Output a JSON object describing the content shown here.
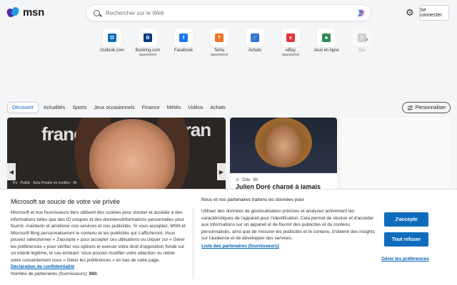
{
  "header": {
    "logo_text": "msn",
    "search_placeholder": "Rechercher sur le Web",
    "signin_label": "Se connecter"
  },
  "shortcuts": [
    {
      "label": "Outlook.com",
      "sub": "",
      "color": "#0f6cbd",
      "icon": "outlook-icon",
      "glyph": "O"
    },
    {
      "label": "Booking.com",
      "sub": "Sponsorisé",
      "color": "#003580",
      "icon": "booking-icon",
      "glyph": "B"
    },
    {
      "label": "Facebook",
      "sub": "",
      "color": "#1877f2",
      "icon": "facebook-icon",
      "glyph": "f"
    },
    {
      "label": "Temu",
      "sub": "Sponsorisé",
      "color": "#f57224",
      "icon": "temu-icon",
      "glyph": "T"
    },
    {
      "label": "Achats",
      "sub": "",
      "color": "#2f6fd8",
      "icon": "shopping-cart-icon",
      "glyph": "🛒"
    },
    {
      "label": "eBay",
      "sub": "Sponsorisé",
      "color": "#e53238",
      "icon": "ebay-icon",
      "glyph": "e"
    },
    {
      "label": "Jeux en ligne",
      "sub": "",
      "color": "#2e8b57",
      "icon": "cards-game-icon",
      "glyph": "♣"
    },
    {
      "label": "Spo",
      "sub": "",
      "color": "#888888",
      "icon": "sports-icon",
      "glyph": "S"
    }
  ],
  "tabs": [
    "Découvrir",
    "Actualités",
    "Sports",
    "Jeux occasionnels",
    "Finance",
    "Météo",
    "Vidéos",
    "Achats"
  ],
  "personalize_label": "Personnaliser",
  "main_card": {
    "bg_text_1": "france",
    "bg_text_2": "fran",
    "caption": "Pu · Public · Actu People en continu · 9h"
  },
  "side_card": {
    "source": "Ode",
    "time": "8h",
    "title": "Julien Doré chargé à jamais"
  },
  "consent": {
    "title": "Microsoft se soucie de votre vie privée",
    "body": "Microsoft et nos fournisseurs tiers utilisent des cookies pour stocker et accéder à des informations telles que des ID uniques et des données/informations personnelles pour fournir, maintenir et améliorer nos services et nos publicités. Si vous acceptez, MSN et Microsoft Bing personnaliseront le contenu et les publicités qui s'afficheront. Vous pouvez sélectionner « J'accepte » pour accepter ces utilisations ou cliquer sur « Gérer les préférences » pour vérifier vos options et exercer votre droit d'opposition fondé sur un intérêt légitime, le cas échéant. Vous pouvez modifier votre sélection ou retirer votre consentement sous « Gérer les préférences » en bas de cette page.",
    "privacy_link": "Déclaration de confidentialité",
    "partners_count_label": "Nombre de partenaires (fournisseurs):",
    "partners_count": "960.",
    "subtitle": "Nous et nos partenaires traitons les données pour",
    "body2": "Utilisez des données de géolocalisation précises et analysez activement les caractéristiques de l'appareil pour l'identification. Cela permet de stocker et d'accéder aux informations sur un appareil et de fournir des publicités et du contenu personnalisés, ainsi que de mesurer les publicités et le contenu, d'obtenir des insights sur l'audience et de développer des services.",
    "partners_link": "Liste des partenaires (fournisseurs)",
    "accept_label": "J'accepte",
    "refuse_label": "Tout refuser",
    "manage_label": "Gérer les préférences"
  }
}
